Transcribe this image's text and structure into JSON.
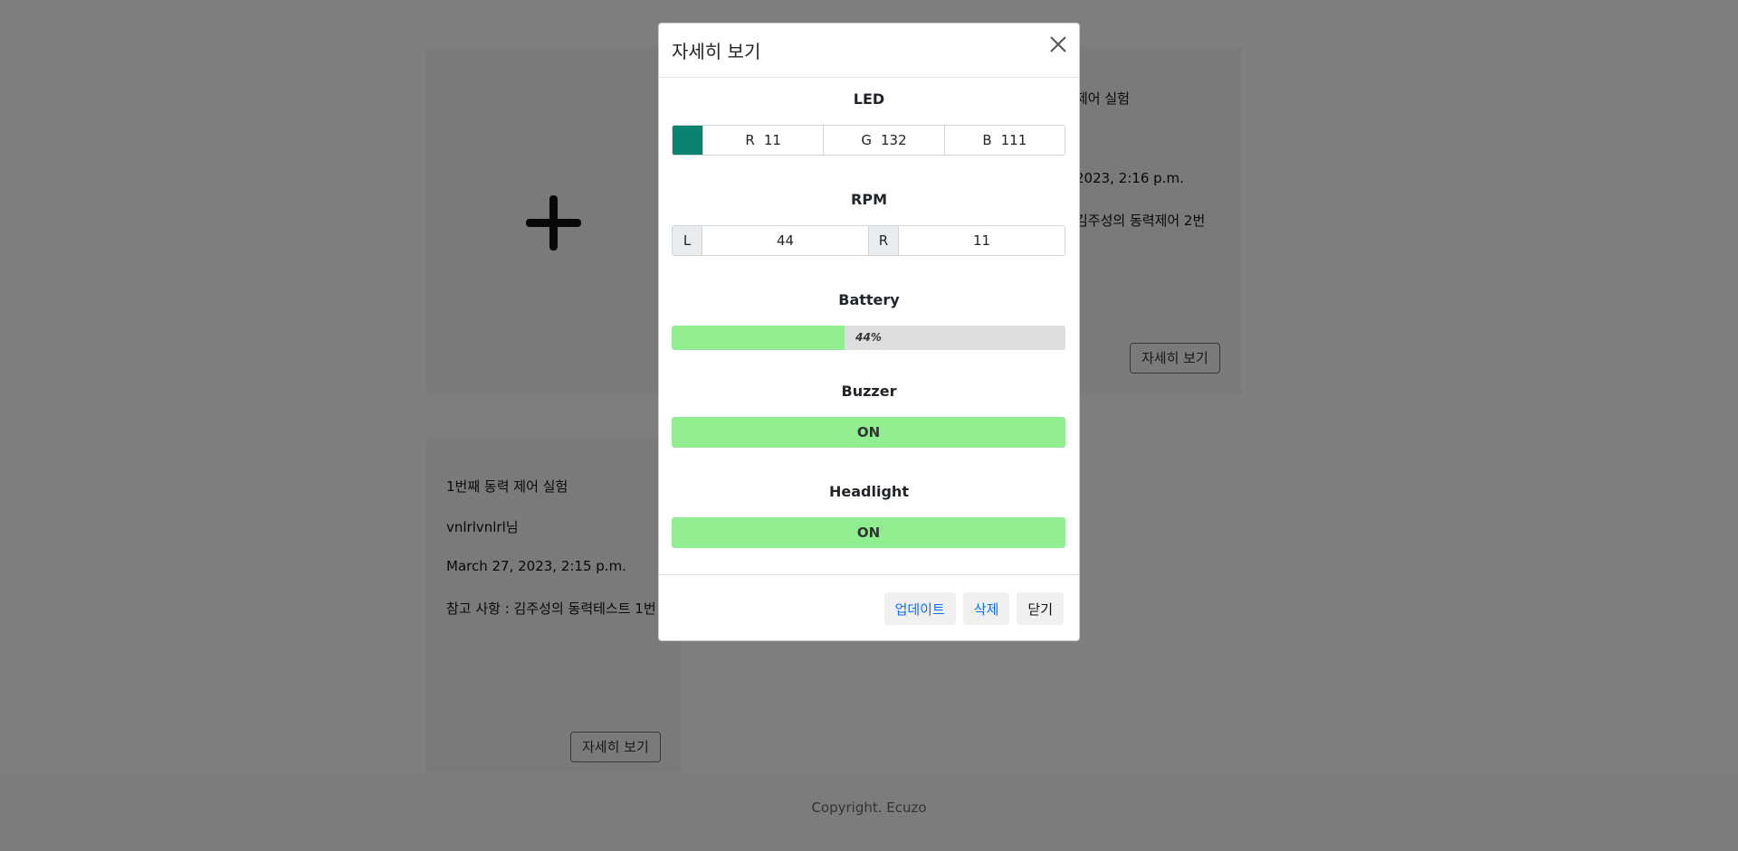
{
  "background": {
    "card2": {
      "title_fragment": "제어 실험",
      "date_fragment": "2023, 2:16 p.m.",
      "note_fragment": "김주성의 동력제어 2번",
      "detail_button": "자세히 보기"
    },
    "card1": {
      "title": "1번째 동력 제어 실험",
      "author": "vnlrlvnlrl님",
      "date": "March 27, 2023, 2:15 p.m.",
      "note": "참고 사항 : 김주성의 동력테스트 1번",
      "detail_button": "자세히 보기"
    },
    "footer": "Copyright. Ecuzo"
  },
  "modal": {
    "title": "자세히 보기",
    "led": {
      "title": "LED",
      "color": "#0b846f",
      "r_label": "R",
      "r_value": "11",
      "g_label": "G",
      "g_value": "132",
      "b_label": "B",
      "b_value": "111"
    },
    "rpm": {
      "title": "RPM",
      "left_label": "L",
      "left_value": "44",
      "right_label": "R",
      "right_value": "11"
    },
    "battery": {
      "title": "Battery",
      "percent": 44,
      "text": "44%",
      "fill_color": "#90ee90"
    },
    "buzzer": {
      "title": "Buzzer",
      "state": "ON"
    },
    "headlight": {
      "title": "Headlight",
      "state": "ON"
    },
    "buttons": {
      "update": "업데이트",
      "delete": "삭제",
      "close": "닫기"
    }
  }
}
